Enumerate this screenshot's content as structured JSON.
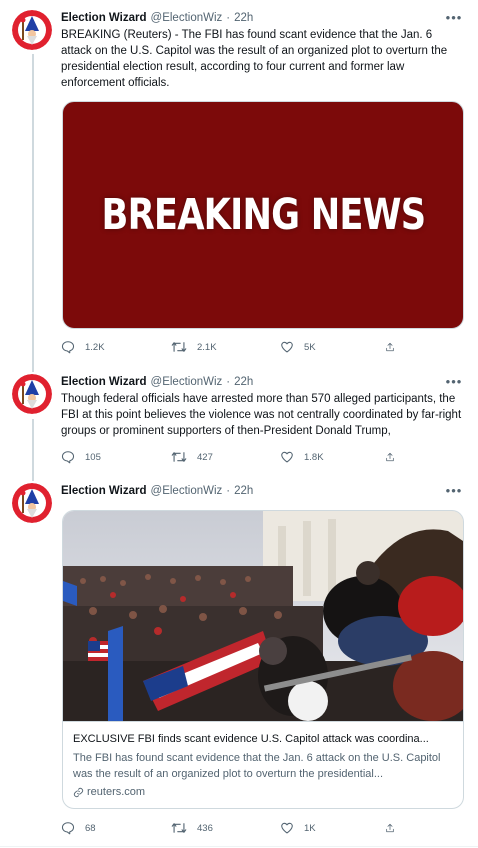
{
  "tweets": [
    {
      "author": "Election Wizard",
      "handle": "@ElectionWiz",
      "time": "22h",
      "text": "BREAKING (Reuters) - The FBI has found scant evidence that the Jan. 6 attack on the U.S. Capitol was the result of an organized plot to overturn the presidential election result, according to four current and former law enforcement officials.",
      "media_text": "BREAKING NEWS",
      "media_color": "#7c0a0a",
      "replies": "1.2K",
      "retweets": "2.1K",
      "likes": "5K"
    },
    {
      "author": "Election Wizard",
      "handle": "@ElectionWiz",
      "time": "22h",
      "text": "Though federal officials have arrested more than 570 alleged participants, the FBI at this point believes the violence was not centrally coordinated by far-right groups or prominent supporters of then-President Donald Trump,",
      "replies": "105",
      "retweets": "427",
      "likes": "1.8K"
    },
    {
      "author": "Election Wizard",
      "handle": "@ElectionWiz",
      "time": "22h",
      "card": {
        "title": "EXCLUSIVE FBI finds scant evidence U.S. Capitol attack was coordina...",
        "description": "The FBI has found scant evidence that the Jan. 6 attack on the U.S. Capitol was the result of an organized plot to overturn the presidential...",
        "domain": "reuters.com"
      },
      "replies": "68",
      "retweets": "436",
      "likes": "1K"
    }
  ],
  "icons": {
    "avatar": "wizard-avatar-icon",
    "more": "more-options-icon",
    "reply": "reply-icon",
    "retweet": "retweet-icon",
    "like": "heart-icon",
    "share": "share-icon",
    "link": "link-icon"
  },
  "colors": {
    "text": "#0f1419",
    "secondary": "#536471",
    "border": "#cfd9de",
    "avatar_bg": "#e0212f"
  }
}
